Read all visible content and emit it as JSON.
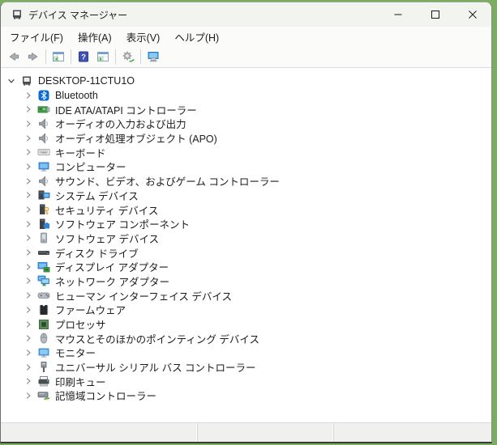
{
  "window": {
    "title": "デバイス マネージャー"
  },
  "menu": {
    "items": [
      {
        "id": "file",
        "label": "ファイル(F)"
      },
      {
        "id": "action",
        "label": "操作(A)"
      },
      {
        "id": "view",
        "label": "表示(V)"
      },
      {
        "id": "help",
        "label": "ヘルプ(H)"
      }
    ]
  },
  "toolbar": {
    "buttons": [
      {
        "type": "button",
        "id": "back",
        "icon": "arrow-left-icon"
      },
      {
        "type": "button",
        "id": "forward",
        "icon": "arrow-right-icon"
      },
      {
        "type": "separator"
      },
      {
        "type": "button",
        "id": "show-console-tree",
        "icon": "console-tree-icon"
      },
      {
        "type": "separator"
      },
      {
        "type": "button",
        "id": "help",
        "icon": "help-icon"
      },
      {
        "type": "button",
        "id": "action-pane",
        "icon": "list-action-icon"
      },
      {
        "type": "separator"
      },
      {
        "type": "button",
        "id": "scan-hardware-changes",
        "icon": "scan-gear-icon"
      },
      {
        "type": "separator"
      },
      {
        "type": "button",
        "id": "device-view",
        "icon": "monitor-device-icon"
      }
    ]
  },
  "tree": {
    "items": [
      {
        "label": "DESKTOP-11CTU1O",
        "icon": "computer-device-icon",
        "level": 0,
        "expanded": true
      },
      {
        "label": "Bluetooth",
        "icon": "bluetooth-icon",
        "level": 1,
        "expanded": false
      },
      {
        "label": "IDE ATA/ATAPI コントローラー",
        "icon": "ide-controller-icon",
        "level": 1,
        "expanded": false
      },
      {
        "label": "オーディオの入力および出力",
        "icon": "speaker-icon",
        "level": 1,
        "expanded": false
      },
      {
        "label": "オーディオ処理オブジェクト (APO)",
        "icon": "speaker-icon",
        "level": 1,
        "expanded": false
      },
      {
        "label": "キーボード",
        "icon": "keyboard-icon",
        "level": 1,
        "expanded": false
      },
      {
        "label": "コンピューター",
        "icon": "computer-monitor-icon",
        "level": 1,
        "expanded": false
      },
      {
        "label": "サウンド、ビデオ、およびゲーム コントローラー",
        "icon": "speaker-icon",
        "level": 1,
        "expanded": false
      },
      {
        "label": "システム デバイス",
        "icon": "system-devices-icon",
        "level": 1,
        "expanded": false
      },
      {
        "label": "セキュリティ デバイス",
        "icon": "security-device-icon",
        "level": 1,
        "expanded": false
      },
      {
        "label": "ソフトウェア コンポーネント",
        "icon": "software-component-icon",
        "level": 1,
        "expanded": false
      },
      {
        "label": "ソフトウェア デバイス",
        "icon": "software-device-icon",
        "level": 1,
        "expanded": false
      },
      {
        "label": "ディスク ドライブ",
        "icon": "disk-drive-icon",
        "level": 1,
        "expanded": false
      },
      {
        "label": "ディスプレイ アダプター",
        "icon": "display-adapter-icon",
        "level": 1,
        "expanded": false
      },
      {
        "label": "ネットワーク アダプター",
        "icon": "network-adapter-icon",
        "level": 1,
        "expanded": false
      },
      {
        "label": "ヒューマン インターフェイス デバイス",
        "icon": "hid-icon",
        "level": 1,
        "expanded": false
      },
      {
        "label": "ファームウェア",
        "icon": "firmware-icon",
        "level": 1,
        "expanded": false
      },
      {
        "label": "プロセッサ",
        "icon": "processor-icon",
        "level": 1,
        "expanded": false
      },
      {
        "label": "マウスとそのほかのポインティング デバイス",
        "icon": "mouse-icon",
        "level": 1,
        "expanded": false
      },
      {
        "label": "モニター",
        "icon": "monitor-icon",
        "level": 1,
        "expanded": false
      },
      {
        "label": "ユニバーサル シリアル バス コントローラー",
        "icon": "usb-icon",
        "level": 1,
        "expanded": false
      },
      {
        "label": "印刷キュー",
        "icon": "printer-icon",
        "level": 1,
        "expanded": false
      },
      {
        "label": "記憶域コントローラー",
        "icon": "storage-controller-icon",
        "level": 1,
        "expanded": false
      }
    ]
  },
  "statusbar": {
    "sections": [
      "",
      "",
      ""
    ]
  },
  "colors": {
    "desktop_green": "#79ad5f",
    "bluetooth_blue": "#0a6cd6",
    "device_green": "#43a047",
    "monitor_blue": "#3d9be9",
    "chrome_bg": "#fbfbfa"
  }
}
